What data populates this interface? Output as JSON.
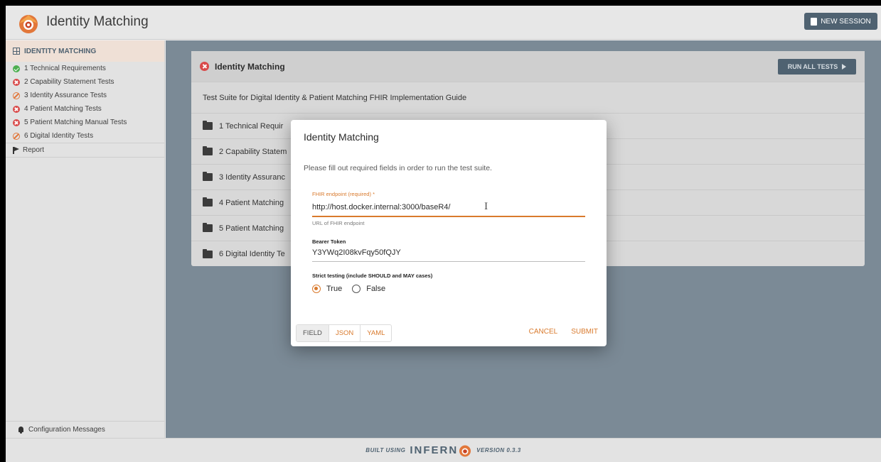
{
  "header": {
    "title": "Identity Matching",
    "new_session_label": "NEW SESSION"
  },
  "sidebar": {
    "heading": "IDENTITY MATCHING",
    "items": [
      {
        "label": "1 Technical Requirements",
        "status": "pass"
      },
      {
        "label": "2 Capability Statement Tests",
        "status": "fail"
      },
      {
        "label": "3 Identity Assurance Tests",
        "status": "skip"
      },
      {
        "label": "4 Patient Matching Tests",
        "status": "fail"
      },
      {
        "label": "5 Patient Matching Manual Tests",
        "status": "fail"
      },
      {
        "label": "6 Digital Identity Tests",
        "status": "skip"
      }
    ],
    "report_label": "Report",
    "config_label": "Configuration Messages"
  },
  "suite": {
    "title": "Identity Matching",
    "status": "fail",
    "run_all_label": "RUN ALL TESTS",
    "description": "Test Suite for Digital Identity & Patient Matching FHIR Implementation Guide",
    "groups": [
      "1 Technical Requir",
      "2 Capability Statem",
      "3 Identity Assuranc",
      "4 Patient Matching",
      "5 Patient Matching",
      "6 Digital Identity Te"
    ]
  },
  "dialog": {
    "title": "Identity Matching",
    "message": "Please fill out required fields in order to run the test suite.",
    "fhir_label": "FHIR endpoint (required)",
    "fhir_value": "http://host.docker.internal:3000/baseR4/",
    "fhir_helper": "URL of FHIR endpoint",
    "bearer_label": "Bearer Token",
    "bearer_value": "Y3YWq2I08kvFqy50fQJY",
    "strict_label": "Strict testing (include SHOULD and MAY cases)",
    "options": [
      {
        "label": "True",
        "selected": true
      },
      {
        "label": "False",
        "selected": false
      }
    ],
    "tabs": [
      "FIELD",
      "JSON",
      "YAML"
    ],
    "active_tab": "FIELD",
    "cancel_label": "CANCEL",
    "submit_label": "SUBMIT"
  },
  "footer": {
    "built_using": "BUILT USING",
    "brand_left": "INFERN",
    "version": "VERSION 0.3.3"
  },
  "colors": {
    "accent": "#d97a2d",
    "primary": "#4f6271",
    "pass": "#4caf50",
    "fail": "#d94a4a"
  }
}
